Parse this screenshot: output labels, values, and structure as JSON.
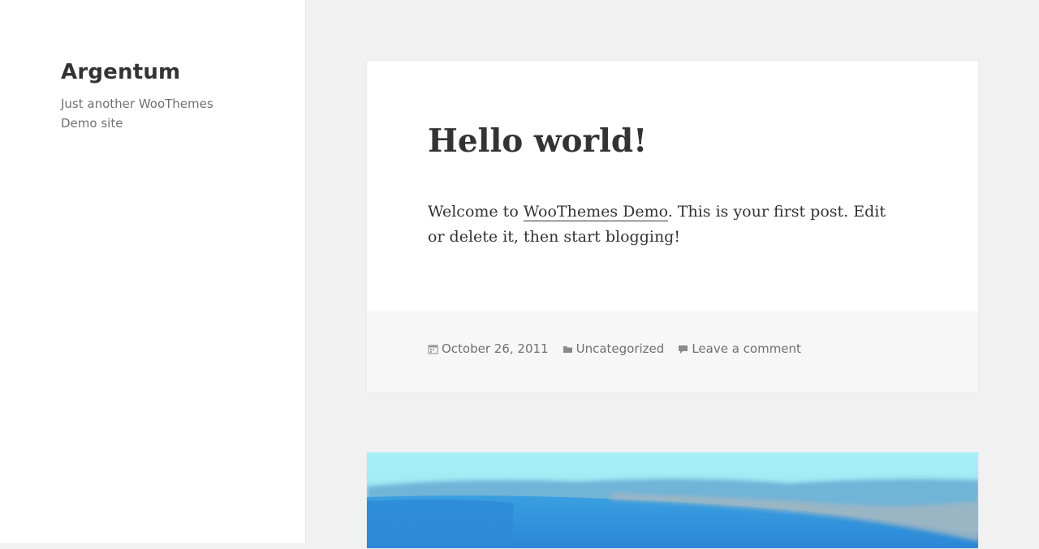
{
  "site": {
    "title": "Argentum",
    "description": "Just another WooThemes Demo site"
  },
  "post": {
    "title": "Hello world!",
    "content_before_link": "Welcome to ",
    "content_link": "WooThemes Demo",
    "content_after_link": ". This is your first post. Edit or delete it, then start blogging!",
    "date": "October 26, 2011",
    "category": "Uncategorized",
    "comments": "Leave a comment"
  },
  "icons": {
    "date": "calendar-icon",
    "category": "folder-icon",
    "comments": "comment-icon"
  },
  "colors": {
    "background": "#f1f1f1",
    "sidebar": "#ffffff",
    "text": "#333333",
    "meta_text": "#707070",
    "footer_bg": "#f7f7f7"
  }
}
